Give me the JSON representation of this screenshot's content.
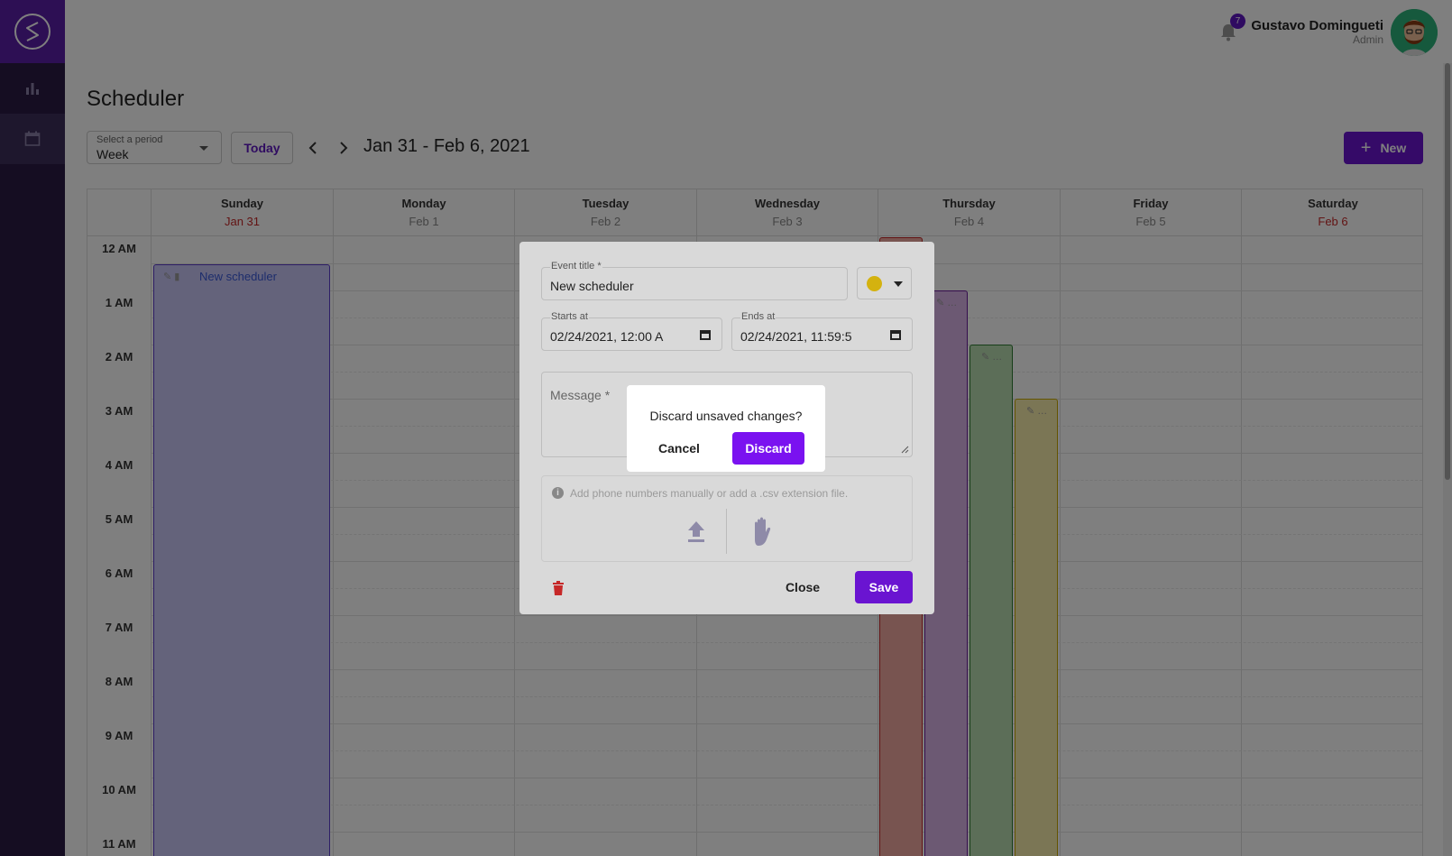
{
  "app": {
    "brand_color": "#5b1fa8",
    "accent": "#6a14d1"
  },
  "topbar": {
    "notification_count": "7",
    "user_name": "Gustavo Domingueti",
    "user_role": "Admin"
  },
  "page": {
    "title": "Scheduler",
    "period_label": "Select a period",
    "period_value": "Week",
    "today_label": "Today",
    "date_range": "Jan 31 - Feb 6, 2021",
    "new_label": "New"
  },
  "calendar": {
    "days": [
      {
        "name": "Sunday",
        "date": "Jan 31",
        "weekend": true
      },
      {
        "name": "Monday",
        "date": "Feb 1",
        "weekend": false
      },
      {
        "name": "Tuesday",
        "date": "Feb 2",
        "weekend": false
      },
      {
        "name": "Wednesday",
        "date": "Feb 3",
        "weekend": false
      },
      {
        "name": "Thursday",
        "date": "Feb 4",
        "weekend": false
      },
      {
        "name": "Friday",
        "date": "Feb 5",
        "weekend": false
      },
      {
        "name": "Saturday",
        "date": "Feb 6",
        "weekend": true
      }
    ],
    "hours": [
      "12 AM",
      "1 AM",
      "2 AM",
      "3 AM",
      "4 AM",
      "5 AM",
      "6 AM",
      "7 AM",
      "8 AM",
      "9 AM",
      "10 AM",
      "11 AM"
    ],
    "events": [
      {
        "title": "New scheduler",
        "color": "#c9c6f7"
      }
    ]
  },
  "modal": {
    "title_label": "Event title *",
    "title_value": "New scheduler",
    "event_color": "#d4b20f",
    "starts_label": "Starts at",
    "starts_value": "02/24/2021, 12:00 A",
    "ends_label": "Ends at",
    "ends_value": "02/24/2021, 11:59:5",
    "message_placeholder": "Message *",
    "phone_hint": "Add phone numbers manually or add a .csv extension file.",
    "close_label": "Close",
    "save_label": "Save"
  },
  "confirm": {
    "question": "Discard unsaved changes?",
    "cancel_label": "Cancel",
    "discard_label": "Discard"
  }
}
